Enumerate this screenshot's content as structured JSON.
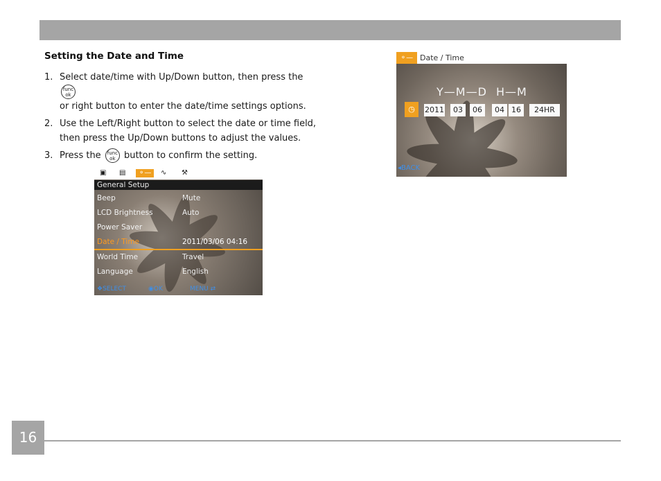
{
  "section": {
    "heading": "Setting the Date and Time",
    "steps": [
      {
        "num": "1.",
        "before": "Select date/time with Up/Down button, then press the",
        "after": "or right button to enter the date/time settings options."
      },
      {
        "num": "2.",
        "text": "Use the Left/Right button to select the date or time field, then press the Up/Down buttons to adjust the values."
      },
      {
        "num": "3.",
        "before": "Press the",
        "after": "button to confirm the setting."
      }
    ],
    "func_button": {
      "line1": "func",
      "line2": "ok"
    }
  },
  "menu_screen": {
    "title": "General Setup",
    "rows": [
      {
        "label": "Beep",
        "value": "Mute"
      },
      {
        "label": "LCD Brightness",
        "value": "Auto"
      },
      {
        "label": "Power Saver",
        "value": ""
      },
      {
        "label": "Date / Time",
        "value": "2011/03/06 04:16"
      },
      {
        "label": "World Time",
        "value": "Travel"
      },
      {
        "label": "Language",
        "value": "English"
      }
    ],
    "footer": {
      "select": "SELECT",
      "ok": "OK",
      "menu": "MENU"
    },
    "icons": [
      "camera-icon",
      "film-icon",
      "key-icon",
      "wave-icon",
      "settings-icon"
    ]
  },
  "datetime_screen": {
    "title": "Date / Time",
    "labels": {
      "date": "Y—M—D",
      "time": "H—M"
    },
    "year": "2011",
    "month": "03",
    "day": "06",
    "hour": "04",
    "minute": "16",
    "format": "24HR",
    "back": "BACK"
  },
  "page_number": "16",
  "colors": {
    "accent": "#f0a020",
    "gray_bar": "#a5a5a5",
    "hint_blue": "#3f8fe8"
  }
}
